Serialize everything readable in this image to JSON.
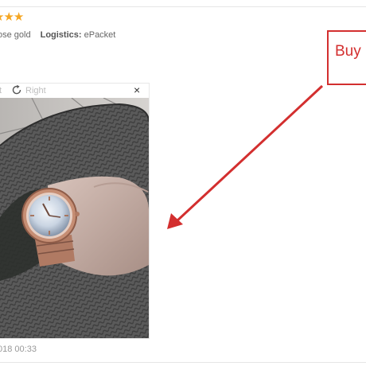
{
  "review": {
    "stars": [
      "★",
      "★",
      "★"
    ],
    "color_label": "ose gold",
    "logistics_key": "Logistics:",
    "logistics_value": "ePacket",
    "date": "018 00:33"
  },
  "viewer": {
    "left_fragment": "t",
    "rotate_right_label": "Right",
    "close_glyph": "×"
  },
  "annotation": {
    "callout_text": "Buy"
  },
  "colors": {
    "star": "#f5a623",
    "annotation_red": "#d32f2f"
  }
}
